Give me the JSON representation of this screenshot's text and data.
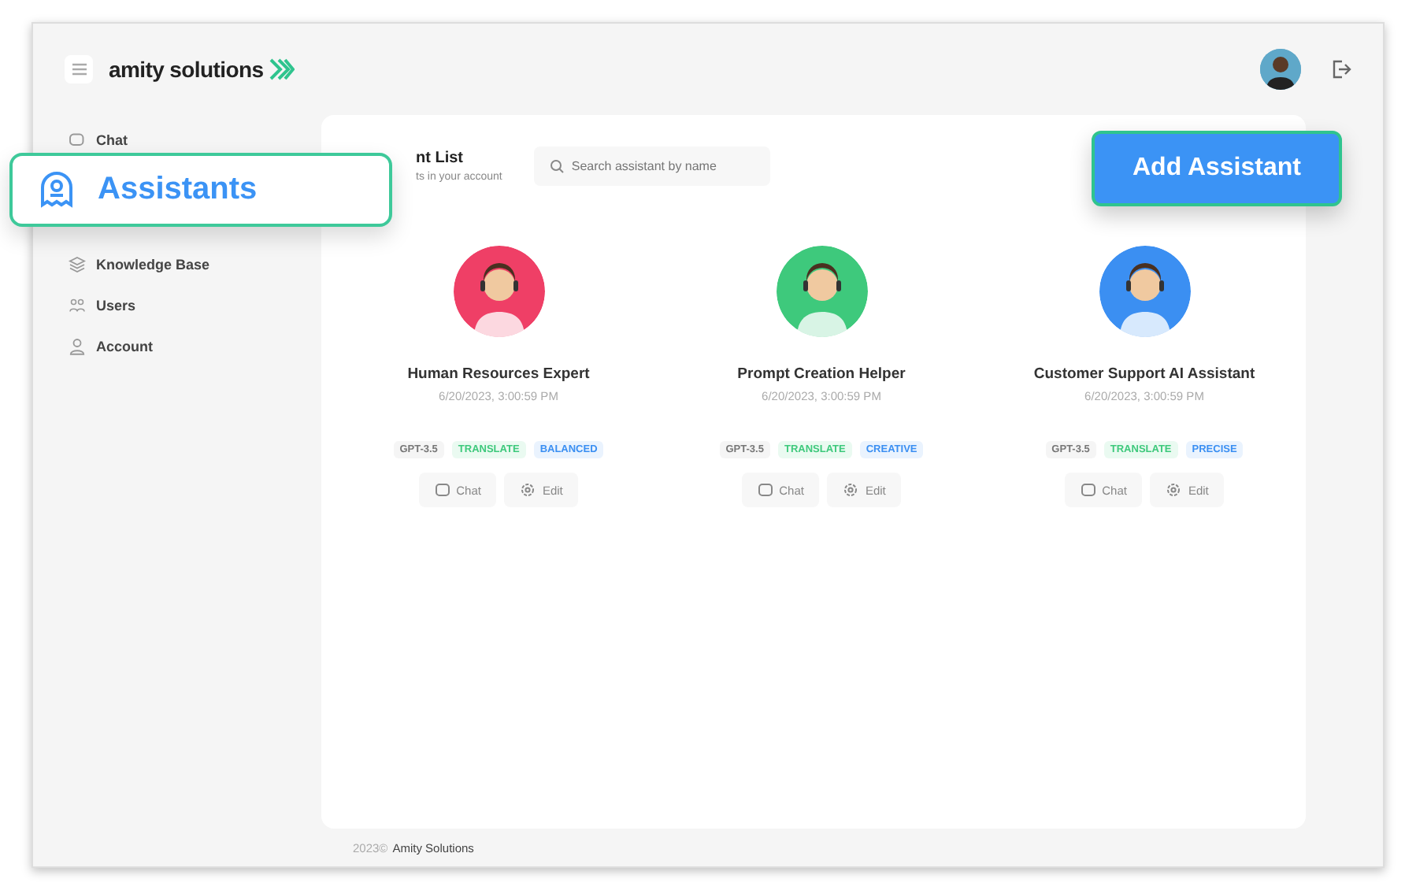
{
  "header": {
    "logo": "amity solutions"
  },
  "sidebar": {
    "items": [
      {
        "label": "Chat",
        "selected": false
      },
      {
        "label": "Knowledge Base",
        "selected": false
      },
      {
        "label": "Users",
        "selected": false
      },
      {
        "label": "Account",
        "selected": false
      }
    ]
  },
  "callout": {
    "label": "Assistants",
    "selected": true
  },
  "content": {
    "title": "nt List",
    "subtitle": "ts in your account",
    "search": {
      "placeholder": "Search assistant by name"
    },
    "add_button": "Add Assistant"
  },
  "assistants": [
    {
      "name": "Human Resources Expert",
      "date": "6/20/2023, 3:00:59 PM",
      "color": "#ef3f66",
      "tags": [
        {
          "label": "GPT-3.5",
          "kind": "model"
        },
        {
          "label": "TRANSLATE",
          "kind": "skill"
        },
        {
          "label": "BALANCED",
          "kind": "mode"
        }
      ],
      "actions": [
        "Chat",
        "Edit"
      ]
    },
    {
      "name": "Prompt Creation Helper",
      "date": "6/20/2023, 3:00:59 PM",
      "color": "#3ec97c",
      "tags": [
        {
          "label": "GPT-3.5",
          "kind": "model"
        },
        {
          "label": "TRANSLATE",
          "kind": "skill"
        },
        {
          "label": "CREATIVE",
          "kind": "mode"
        }
      ],
      "actions": [
        "Chat",
        "Edit"
      ]
    },
    {
      "name": "Customer Support AI Assistant",
      "date": "6/20/2023, 3:00:59 PM",
      "color": "#3b8ff2",
      "tags": [
        {
          "label": "GPT-3.5",
          "kind": "model"
        },
        {
          "label": "TRANSLATE",
          "kind": "skill"
        },
        {
          "label": "PRECISE",
          "kind": "mode"
        }
      ],
      "actions": [
        "Chat",
        "Edit"
      ]
    }
  ],
  "footer": {
    "year": "2023©",
    "company": "Amity Solutions"
  }
}
